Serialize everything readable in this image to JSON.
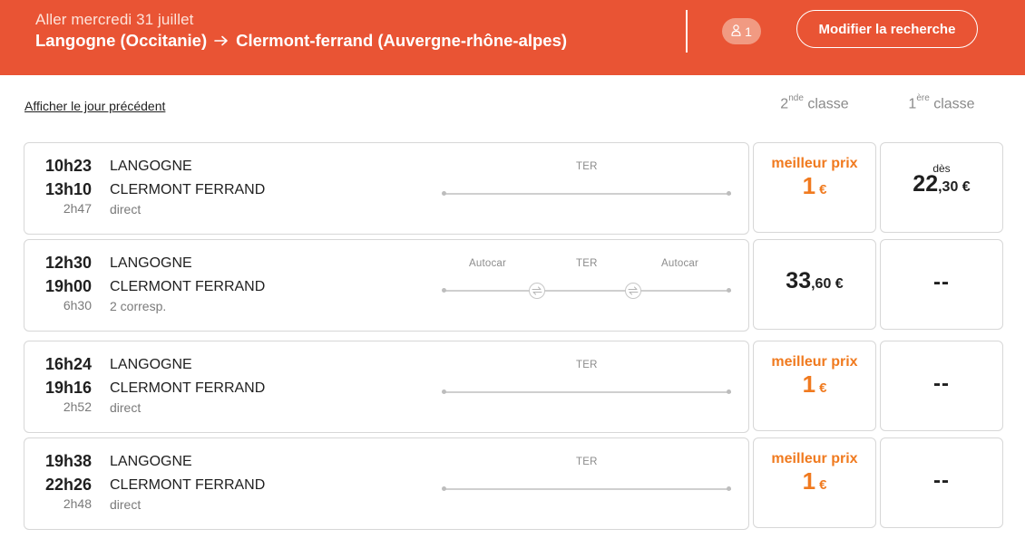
{
  "header": {
    "date": "Aller mercredi 31 juillet",
    "origin": "Langogne (Occitanie)",
    "destination": "Clermont-ferrand (Auvergne-rhône-alpes)",
    "passengers": "1",
    "modify_label": "Modifier la recherche",
    "accent_color": "#e95434"
  },
  "nav": {
    "previous_day": "Afficher le jour précédent"
  },
  "classes": {
    "second_num": "2",
    "second_sup": "nde",
    "second_label": "classe",
    "first_num": "1",
    "first_sup": "ère",
    "first_label": "classe"
  },
  "trips": [
    {
      "dep_time": "10h23",
      "arr_time": "13h10",
      "duration": "2h47",
      "dep_station": "LANGOGNE",
      "arr_station": "CLERMONT FERRAND",
      "connections": "direct",
      "modes": [
        "TER"
      ],
      "second": {
        "best_label": "meilleur prix",
        "amount": "1",
        "currency": "€"
      },
      "first": {
        "from": "dès",
        "euros": "22",
        "cents": ",30 €"
      }
    },
    {
      "dep_time": "12h30",
      "arr_time": "19h00",
      "duration": "6h30",
      "dep_station": "LANGOGNE",
      "arr_station": "CLERMONT FERRAND",
      "connections": "2 corresp.",
      "modes": [
        "Autocar",
        "TER",
        "Autocar"
      ],
      "second": {
        "euros": "33",
        "cents": ",60 €"
      },
      "first": {
        "na": "--"
      }
    },
    {
      "dep_time": "16h24",
      "arr_time": "19h16",
      "duration": "2h52",
      "dep_station": "LANGOGNE",
      "arr_station": "CLERMONT FERRAND",
      "connections": "direct",
      "modes": [
        "TER"
      ],
      "second": {
        "best_label": "meilleur prix",
        "amount": "1",
        "currency": "€"
      },
      "first": {
        "na": "--"
      }
    },
    {
      "dep_time": "19h38",
      "arr_time": "22h26",
      "duration": "2h48",
      "dep_station": "LANGOGNE",
      "arr_station": "CLERMONT FERRAND",
      "connections": "direct",
      "modes": [
        "TER"
      ],
      "second": {
        "best_label": "meilleur prix",
        "amount": "1",
        "currency": "€"
      },
      "first": {
        "na": "--"
      }
    }
  ],
  "icons": {
    "arrow": "arrow-right-icon",
    "passenger": "person-icon",
    "connection": "connection-swap-icon"
  }
}
